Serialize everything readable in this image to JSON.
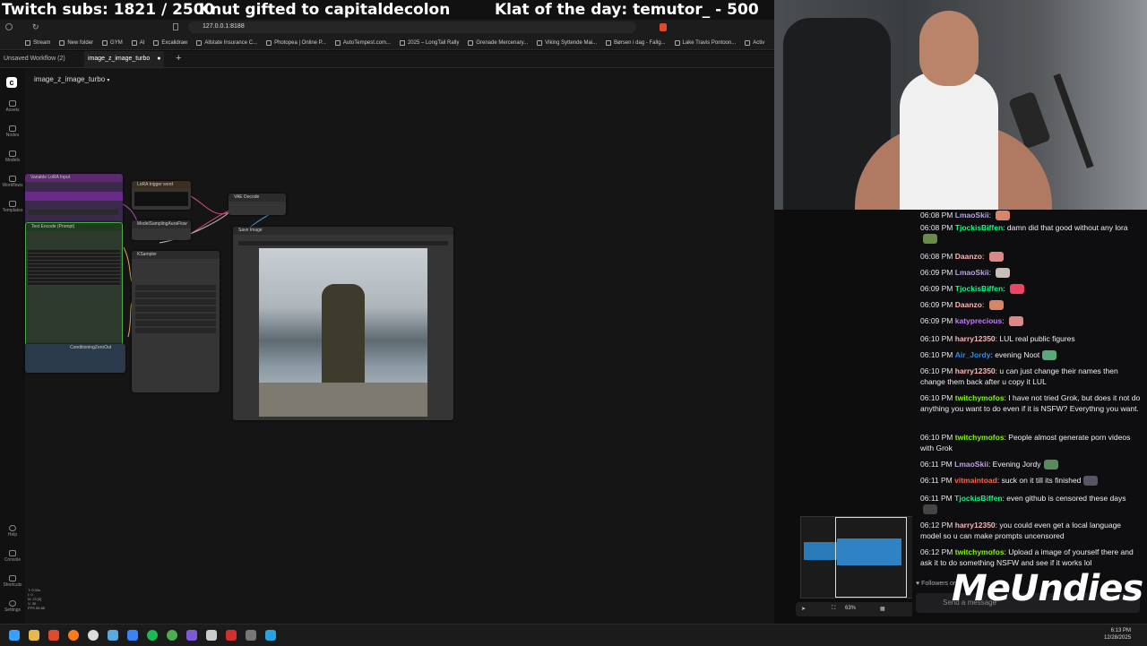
{
  "overlay": {
    "subs": "Twitch subs: 1821 / 2500",
    "gift": "Knut gifted to capitaldecolon",
    "klat": "Klat of the day: temutor_ - 500"
  },
  "browser": {
    "url": "127.0.0.1:8188",
    "bookmarks": [
      "Stream",
      "New folder",
      "GYM",
      "AI",
      "Excalidraw",
      "Allstate Insurance C...",
      "Photopea | Online P...",
      "AutoTempest.com...",
      "2025 – LongTail Rally",
      "Grenade Mercenary...",
      "Viking Syttende Mai...",
      "Børsen i dag - Fallg...",
      "Lake Travis Pontoon...",
      "Activ"
    ]
  },
  "tabs": [
    {
      "label": "Unsaved Workflow (2)"
    },
    {
      "label": "image_z_image_turbo"
    }
  ],
  "workflow": {
    "title": "image_z_image_turbo"
  },
  "rail": {
    "top": [
      "Assets",
      "Nodes",
      "Models",
      "Workflows",
      "Templates"
    ],
    "bottom": [
      "Help",
      "Console",
      "Shortcuts",
      "Settings"
    ]
  },
  "stats": {
    "t": "T: 0.00s",
    "i": "I: 0",
    "n": "N: 13 [0]",
    "v": "V: 30",
    "fps": "FPS 59.88"
  },
  "nodes": {
    "lora_input": "Variable LoRA Input",
    "lora_trigger": "LoRA trigger word",
    "vae_decode": "VAE Decode",
    "model_sampling": "ModelSamplingAuraFlow",
    "ksampler": "KSampler",
    "text_encode": "Text Encode (Prompt)",
    "cond_zero": "ConditioningZeroOut",
    "save_image": "Save Image"
  },
  "zoom": "63%",
  "chat": [
    {
      "time": "06:08 PM",
      "user": "LmaoSkii",
      "color": "#b9a3e3",
      "text": ""
    },
    {
      "time": "06:08 PM",
      "user": "TjockisBiffen",
      "color": "#00ff7f",
      "text": "damn did that good without any lora"
    },
    {
      "time": "06:08 PM",
      "user": "Daanzo",
      "color": "#ffb3b3",
      "text": ""
    },
    {
      "time": "06:09 PM",
      "user": "LmaoSkii",
      "color": "#b9a3e3",
      "text": ""
    },
    {
      "time": "06:09 PM",
      "user": "TjockisBiffen",
      "color": "#00ff7f",
      "text": ""
    },
    {
      "time": "06:09 PM",
      "user": "Daanzo",
      "color": "#ffb3b3",
      "text": ""
    },
    {
      "time": "06:09 PM",
      "user": "katyprecious",
      "color": "#c678ff",
      "text": ""
    },
    {
      "time": "06:10 PM",
      "user": "harry12350",
      "color": "#ffb3b3",
      "text": "LUL real public figures"
    },
    {
      "time": "06:10 PM",
      "user": "Air_Jordy",
      "color": "#1e90ff",
      "text": "evening Noot"
    },
    {
      "time": "06:10 PM",
      "user": "harry12350",
      "color": "#ffb3b3",
      "text": "u can just change their names then change them back after u copy it LUL"
    },
    {
      "time": "06:10 PM",
      "user": "twitchymofos",
      "color": "#7cfc00",
      "text": "I have not tried Grok, but does it not do anything you want to do even if it is NSFW? Everythng you want."
    },
    {
      "time": "06:10 PM",
      "user": "twitchymofos",
      "color": "#7cfc00",
      "text": "People almost generate porn videos with Grok"
    },
    {
      "time": "06:11 PM",
      "user": "LmaoSkii",
      "color": "#b9a3e3",
      "text": "Evening Jordy"
    },
    {
      "time": "06:11 PM",
      "user": "vitmaintoad",
      "color": "#ff6347",
      "text": "suck on it till its finished"
    },
    {
      "time": "06:11 PM",
      "user": "TjockisBiffen",
      "color": "#00ff7f",
      "text": "even github is censored these days"
    },
    {
      "time": "06:12 PM",
      "user": "harry12350",
      "color": "#ffb3b3",
      "text": "you could even get a local language model so u can make prompts uncensored"
    },
    {
      "time": "06:12 PM",
      "user": "twitchymofos",
      "color": "#7cfc00",
      "text": "Upload a image of yourself there and ask it to do something NSFW and see if it works lol"
    }
  ],
  "chat_footer": {
    "followers": "Followers only",
    "send_placeholder": "Send a message"
  },
  "sponsor": "MeUndies",
  "clock": {
    "time": "6:13 PM",
    "date": "12/28/2025"
  }
}
